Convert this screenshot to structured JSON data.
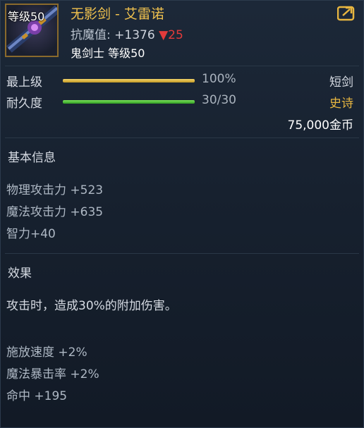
{
  "item": {
    "level_badge": "等级50",
    "name": "无影剑 - 艾雷诺",
    "resist_label": "抗魔值:",
    "resist_value": "+1376",
    "resist_change_arrow": "▼",
    "resist_change": "25",
    "requirement": "鬼剑士 等级50"
  },
  "stats": {
    "grade_label": "最上级",
    "grade_fill_percent": 100,
    "grade_value": "100%",
    "weapon_type": "短剑",
    "durability_label": "耐久度",
    "durability_current": 30,
    "durability_max": 30,
    "durability_value": "30/30",
    "rarity": "史诗",
    "price": "75,000金币"
  },
  "basic": {
    "title": "基本信息",
    "attrs": [
      "物理攻击力 +523",
      "魔法攻击力 +635",
      "智力+40"
    ]
  },
  "effect": {
    "title": "效果",
    "desc": "攻击时，造成30%的附加伤害。",
    "attrs": [
      "施放速度 +2%",
      "魔法暴击率 +2%",
      "命中 +195"
    ]
  },
  "colors": {
    "name": "#f1c24e",
    "rarity": "#e8b640",
    "resist_down": "#e23b3b"
  },
  "icons": {
    "share": "share-icon",
    "item": "sword-icon"
  }
}
